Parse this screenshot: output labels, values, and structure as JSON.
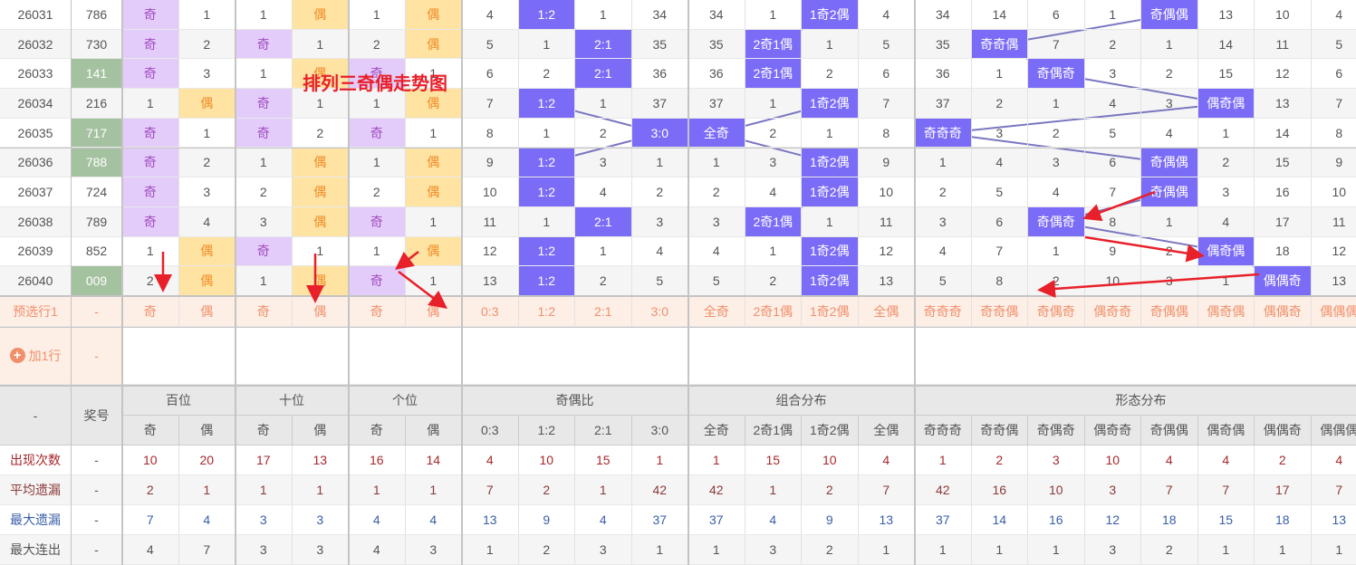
{
  "title_overlay": "排列三奇偶走势图",
  "colors": {
    "odd_bg": "#e4ccfa",
    "even_bg": "#ffe3a3",
    "hit_bg": "#7b6cf7",
    "number_highlight": "#a5c2a0",
    "preselect_bg": "#fdeee6",
    "arrow": "#e8202a",
    "line": "#7a76c0"
  },
  "rows": [
    {
      "issue": "26031",
      "number": "786",
      "hl": false,
      "cells": [
        "奇",
        "1",
        "1",
        "偶",
        "1",
        "偶",
        "4",
        "1:2",
        "1",
        "34",
        "34",
        "1",
        "1奇2偶",
        "4",
        "34",
        "14",
        "6",
        "1",
        "奇偶偶",
        "13",
        "10",
        "4"
      ]
    },
    {
      "issue": "26032",
      "number": "730",
      "hl": false,
      "cells": [
        "奇",
        "2",
        "奇",
        "1",
        "2",
        "偶",
        "5",
        "1",
        "2:1",
        "35",
        "35",
        "2奇1偶",
        "1",
        "5",
        "35",
        "奇奇偶",
        "7",
        "2",
        "1",
        "14",
        "11",
        "5"
      ]
    },
    {
      "issue": "26033",
      "number": "141",
      "hl": true,
      "cells": [
        "奇",
        "3",
        "1",
        "偶",
        "奇",
        "1",
        "6",
        "2",
        "2:1",
        "36",
        "36",
        "2奇1偶",
        "2",
        "6",
        "36",
        "1",
        "奇偶奇",
        "3",
        "2",
        "15",
        "12",
        "6"
      ]
    },
    {
      "issue": "26034",
      "number": "216",
      "hl": false,
      "cells": [
        "1",
        "偶",
        "奇",
        "1",
        "1",
        "偶",
        "7",
        "1:2",
        "1",
        "37",
        "37",
        "1",
        "1奇2偶",
        "7",
        "37",
        "2",
        "1",
        "4",
        "3",
        "偶奇偶",
        "13",
        "7"
      ]
    },
    {
      "issue": "26035",
      "number": "717",
      "hl": true,
      "cells": [
        "奇",
        "1",
        "奇",
        "2",
        "奇",
        "1",
        "8",
        "1",
        "2",
        "3:0",
        "全奇",
        "2",
        "1",
        "8",
        "奇奇奇",
        "3",
        "2",
        "5",
        "4",
        "1",
        "14",
        "8"
      ]
    },
    {
      "issue": "26036",
      "number": "788",
      "hl": true,
      "cells": [
        "奇",
        "2",
        "1",
        "偶",
        "1",
        "偶",
        "9",
        "1:2",
        "3",
        "1",
        "1",
        "3",
        "1奇2偶",
        "9",
        "1",
        "4",
        "3",
        "6",
        "奇偶偶",
        "2",
        "15",
        "9"
      ]
    },
    {
      "issue": "26037",
      "number": "724",
      "hl": false,
      "cells": [
        "奇",
        "3",
        "2",
        "偶",
        "2",
        "偶",
        "10",
        "1:2",
        "4",
        "2",
        "2",
        "4",
        "1奇2偶",
        "10",
        "2",
        "5",
        "4",
        "7",
        "奇偶偶",
        "3",
        "16",
        "10"
      ]
    },
    {
      "issue": "26038",
      "number": "789",
      "hl": false,
      "cells": [
        "奇",
        "4",
        "3",
        "偶",
        "奇",
        "1",
        "11",
        "1",
        "2:1",
        "3",
        "3",
        "2奇1偶",
        "1",
        "11",
        "3",
        "6",
        "奇偶奇",
        "8",
        "1",
        "4",
        "17",
        "11"
      ]
    },
    {
      "issue": "26039",
      "number": "852",
      "hl": false,
      "cells": [
        "1",
        "偶",
        "奇",
        "1",
        "1",
        "偶",
        "12",
        "1:2",
        "1",
        "4",
        "4",
        "1",
        "1奇2偶",
        "12",
        "4",
        "7",
        "1",
        "9",
        "2",
        "偶奇偶",
        "18",
        "12"
      ]
    },
    {
      "issue": "26040",
      "number": "009",
      "hl": true,
      "cells": [
        "2",
        "偶",
        "1",
        "偶",
        "奇",
        "1",
        "13",
        "1:2",
        "2",
        "5",
        "5",
        "2",
        "1奇2偶",
        "13",
        "5",
        "8",
        "2",
        "10",
        "3",
        "1",
        "偶偶奇",
        "13"
      ]
    }
  ],
  "preselect": {
    "label": "预选行1",
    "number": "-",
    "cells": [
      "奇",
      "偶",
      "奇",
      "偶",
      "奇",
      "偶",
      "0:3",
      "1:2",
      "2:1",
      "3:0",
      "全奇",
      "2奇1偶",
      "1奇2偶",
      "全偶",
      "奇奇奇",
      "奇奇偶",
      "奇偶奇",
      "偶奇奇",
      "奇偶偶",
      "偶奇偶",
      "偶偶奇",
      "偶偶偶"
    ]
  },
  "add_row": {
    "label": "加1行",
    "number": "-",
    "icon": "plus-circle-icon"
  },
  "header": {
    "corner": "-",
    "number_label": "奖号",
    "groups": [
      {
        "label": "百位",
        "span": 2
      },
      {
        "label": "十位",
        "span": 2
      },
      {
        "label": "个位",
        "span": 2
      },
      {
        "label": "奇偶比",
        "span": 4
      },
      {
        "label": "组合分布",
        "span": 4
      },
      {
        "label": "形态分布",
        "span": 8
      }
    ],
    "sub": [
      "奇",
      "偶",
      "奇",
      "偶",
      "奇",
      "偶",
      "0:3",
      "1:2",
      "2:1",
      "3:0",
      "全奇",
      "2奇1偶",
      "1奇2偶",
      "全偶",
      "奇奇奇",
      "奇奇偶",
      "奇偶奇",
      "偶奇奇",
      "奇偶偶",
      "偶奇偶",
      "偶偶奇",
      "偶偶偶"
    ]
  },
  "stats": [
    {
      "label": "出现次数",
      "dash": "-",
      "color": "#a8282c",
      "values": [
        "10",
        "20",
        "17",
        "13",
        "16",
        "14",
        "4",
        "10",
        "15",
        "1",
        "1",
        "15",
        "10",
        "4",
        "1",
        "2",
        "3",
        "10",
        "4",
        "4",
        "2",
        "4"
      ]
    },
    {
      "label": "平均遗漏",
      "dash": "-",
      "color": "#8b3a3a",
      "values": [
        "2",
        "1",
        "1",
        "1",
        "1",
        "1",
        "7",
        "2",
        "1",
        "42",
        "42",
        "1",
        "2",
        "7",
        "42",
        "16",
        "10",
        "3",
        "7",
        "7",
        "17",
        "7"
      ]
    },
    {
      "label": "最大遗漏",
      "dash": "-",
      "color": "#3a5ea8",
      "values": [
        "7",
        "4",
        "3",
        "3",
        "4",
        "4",
        "13",
        "9",
        "4",
        "37",
        "37",
        "4",
        "9",
        "13",
        "37",
        "14",
        "16",
        "12",
        "18",
        "15",
        "18",
        "13"
      ]
    },
    {
      "label": "最大连出",
      "dash": "-",
      "color": "#555555",
      "values": [
        "4",
        "7",
        "3",
        "3",
        "4",
        "3",
        "1",
        "2",
        "3",
        "1",
        "1",
        "3",
        "2",
        "1",
        "1",
        "1",
        "1",
        "3",
        "2",
        "1",
        "1",
        "1"
      ]
    }
  ]
}
